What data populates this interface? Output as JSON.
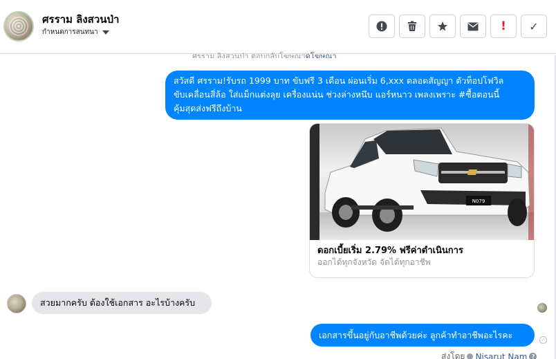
{
  "header": {
    "contact_name": "ศรราม ลิงสวนป่า",
    "manage_label": "กำหนดการสนทนา",
    "toolbar": [
      {
        "name": "report-button",
        "icon": "alert-circle-icon",
        "glyph": "!"
      },
      {
        "name": "delete-button",
        "icon": "trash-icon",
        "glyph": "🗑"
      },
      {
        "name": "star-button",
        "icon": "star-icon",
        "glyph": "★"
      },
      {
        "name": "email-button",
        "icon": "envelope-icon",
        "glyph": "✉"
      },
      {
        "name": "spam-button",
        "icon": "exclamation-icon",
        "glyph": "!"
      },
      {
        "name": "done-button",
        "icon": "check-icon",
        "glyph": "✓"
      }
    ]
  },
  "top_text": {
    "prefix": "ศรราม ลิงสวนป่า ตอบกลับโฆษณา",
    "link": "ดูโฆษณา"
  },
  "messages": {
    "outgoing_1": {
      "line1": "สวัสดี ศรราม!รับรถ 1999 บาท ขับฟรี 3 เดือน ผ่อนเริ่ม 6,xxx ตลอดสัญญา ตัวท็อปโฟวิล",
      "line2": "ขับเคลื่อนสี่ล้อ ใส่แม็กแต่งลุย  เครื่องแน่น ช่วงล่างหนึบ แอร์หนาว เพลงเพราะ #ซื้อตอนนี้",
      "line3": "คุ้มสุดส่งฟรีถึงบ้าน"
    },
    "card": {
      "title": "ดอกเบี้ยเริ่ม 2.79% ฟรีค่าดำเนินการ",
      "subtitle": "ออกได้ทุกจังหวัด จัดได้ทุกอาชีพ",
      "plate": "N079"
    },
    "incoming_1": "สวยมากครับ ต้องใช้เอกสาร อะไรบ้างครับ",
    "outgoing_2": "เอกสารขึ้นอยู่กับอาชีพด้วยค่ะ ลูกค้าทำอาชีพอะไรคะ",
    "sent_by_label": "ส่งโดย",
    "sent_by_name": "Nisarut Nam",
    "help_glyph": "?"
  },
  "colors": {
    "outgoing_bubble": "#0084ff",
    "incoming_bubble": "#e4e6eb",
    "spam_red": "#e41e3f"
  }
}
